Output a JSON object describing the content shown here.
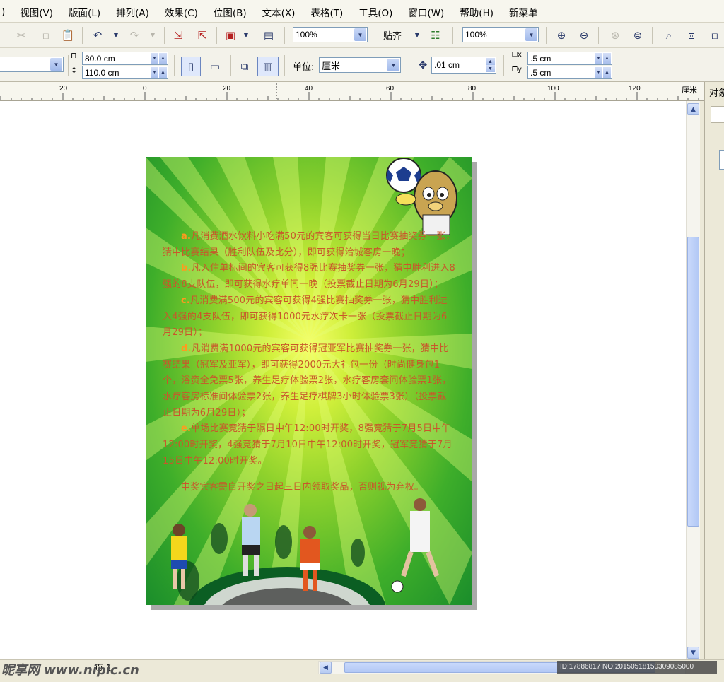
{
  "menu": [
    "视图(V)",
    "版面(L)",
    "排列(A)",
    "效果(C)",
    "位图(B)",
    "文本(X)",
    "表格(T)",
    "工具(O)",
    "窗口(W)",
    "帮助(H)",
    "新菜单"
  ],
  "menu_left_fragment": ")",
  "toolbar": {
    "zoom_value": "100%",
    "snap_label": "贴齐",
    "zoom_value2": "100%"
  },
  "property_bar": {
    "width": "80.0 cm",
    "height": "110.0 cm",
    "unit_label": "单位:",
    "unit_value": "厘米",
    "nudge": ".01 cm",
    "dup_x": ".5 cm",
    "dup_y": ".5 cm"
  },
  "ruler": {
    "ticks": [
      "20",
      "0",
      "20",
      "40",
      "60",
      "80",
      "100",
      "120"
    ],
    "unit": "厘米"
  },
  "dock": {
    "title": "对象"
  },
  "flyer": {
    "paragraphs": [
      {
        "key": "a.",
        "text": "凡消费酒水饮料小吃满50元的宾客可获得当日比赛抽奖券一张，猜中比赛结果（胜利队伍及比分），即可获得洽城客房一晚；"
      },
      {
        "key": "b.",
        "text": "凡入住单标间的宾客可获得8强比赛抽奖券一张，猜中胜利进入8强的8支队伍，即可获得水疗单间一晚（投票截止日期为6月29日）；"
      },
      {
        "key": "c.",
        "text": "凡消费满500元的宾客可获得4强比赛抽奖券一张，猜中胜利进入4强的4支队伍，即可获得1000元水疗次卡一张（投票截止日期为6月29日）；"
      },
      {
        "key": "d.",
        "text": "凡消费满1000元的宾客可获得冠亚军比赛抽奖券一张，猜中比赛结果（冠军及亚军），即可获得2000元大礼包一份（时尚健身包1个，浴资全免票5张，养生足疗体验票2张，水疗客房套间体验票1张，水疗客房标准间体验票2张，养生足疗棋牌3小时体验票3张）（投票截止日期为6月29日）；"
      },
      {
        "key": "e.",
        "text": "单场比赛竞猜于隔日中午12:00时开奖，8强竞猜于7月5日中午12:00时开奖，4强竞猜于7月10日中午12:00时开奖，冠军竞猜于7月15日中午12:00时开奖。"
      }
    ],
    "footer": "中奖宾客需自开奖之日起三日内领取奖品，否则视为弃权。"
  },
  "bottom": {
    "page_label": "页 1",
    "watermark_left": "昵享网 www.nipic.cn",
    "watermark_right": "ID:17886817 NO:20150518150309085000"
  },
  "colors": {
    "flyer_text": "#c8572b",
    "flyer_key": "#ff9a1e",
    "canvas_bg": "#ffffff",
    "chrome_bg": "#ece9d8"
  }
}
